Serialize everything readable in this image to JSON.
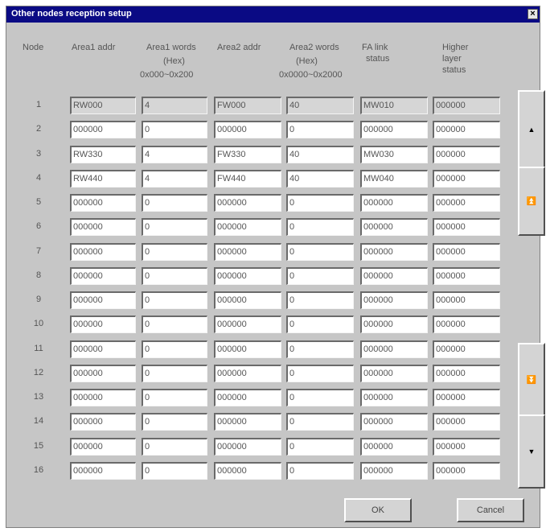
{
  "window": {
    "title": "Other nodes reception setup",
    "close_glyph": "×"
  },
  "headers": {
    "node": "Node",
    "area1_addr": "Area1 addr",
    "area1_words": "Area1 words",
    "area1_words_hex": "(Hex)",
    "area1_words_range": "0x000~0x200",
    "area2_addr": "Area2 addr",
    "area2_words": "Area2 words",
    "area2_words_hex": "(Hex)",
    "area2_words_range": "0x0000~0x2000",
    "fa_link_1": "FA link",
    "fa_link_2": "status",
    "higher_1": "Higher",
    "higher_2": "layer",
    "higher_3": "status"
  },
  "rows": [
    {
      "node": "1",
      "a1addr": "RW000",
      "a1words": "4",
      "a2addr": "FW000",
      "a2words": "40",
      "fa": "MW010",
      "hl": "000000",
      "readonly": true
    },
    {
      "node": "2",
      "a1addr": "000000",
      "a1words": "0",
      "a2addr": "000000",
      "a2words": "0",
      "fa": "000000",
      "hl": "000000"
    },
    {
      "node": "3",
      "a1addr": "RW330",
      "a1words": "4",
      "a2addr": "FW330",
      "a2words": "40",
      "fa": "MW030",
      "hl": "000000"
    },
    {
      "node": "4",
      "a1addr": "RW440",
      "a1words": "4",
      "a2addr": "FW440",
      "a2words": "40",
      "fa": "MW040",
      "hl": "000000"
    },
    {
      "node": "5",
      "a1addr": "000000",
      "a1words": "0",
      "a2addr": "000000",
      "a2words": "0",
      "fa": "000000",
      "hl": "000000"
    },
    {
      "node": "6",
      "a1addr": "000000",
      "a1words": "0",
      "a2addr": "000000",
      "a2words": "0",
      "fa": "000000",
      "hl": "000000"
    },
    {
      "node": "7",
      "a1addr": "000000",
      "a1words": "0",
      "a2addr": "000000",
      "a2words": "0",
      "fa": "000000",
      "hl": "000000"
    },
    {
      "node": "8",
      "a1addr": "000000",
      "a1words": "0",
      "a2addr": "000000",
      "a2words": "0",
      "fa": "000000",
      "hl": "000000"
    },
    {
      "node": "9",
      "a1addr": "000000",
      "a1words": "0",
      "a2addr": "000000",
      "a2words": "0",
      "fa": "000000",
      "hl": "000000"
    },
    {
      "node": "10",
      "a1addr": "000000",
      "a1words": "0",
      "a2addr": "000000",
      "a2words": "0",
      "fa": "000000",
      "hl": "000000"
    },
    {
      "node": "11",
      "a1addr": "000000",
      "a1words": "0",
      "a2addr": "000000",
      "a2words": "0",
      "fa": "000000",
      "hl": "000000"
    },
    {
      "node": "12",
      "a1addr": "000000",
      "a1words": "0",
      "a2addr": "000000",
      "a2words": "0",
      "fa": "000000",
      "hl": "000000"
    },
    {
      "node": "13",
      "a1addr": "000000",
      "a1words": "0",
      "a2addr": "000000",
      "a2words": "0",
      "fa": "000000",
      "hl": "000000"
    },
    {
      "node": "14",
      "a1addr": "000000",
      "a1words": "0",
      "a2addr": "000000",
      "a2words": "0",
      "fa": "000000",
      "hl": "000000"
    },
    {
      "node": "15",
      "a1addr": "000000",
      "a1words": "0",
      "a2addr": "000000",
      "a2words": "0",
      "fa": "000000",
      "hl": "000000"
    },
    {
      "node": "16",
      "a1addr": "000000",
      "a1words": "0",
      "a2addr": "000000",
      "a2words": "0",
      "fa": "000000",
      "hl": "000000"
    }
  ],
  "scroll": {
    "up_icon": "triangle-up-icon",
    "up_glyph": "▲",
    "page_up_icon": "double-up-icon",
    "page_up_glyph": "⏫",
    "page_down_icon": "double-down-icon",
    "page_down_glyph": "⏬",
    "down_icon": "triangle-down-icon",
    "down_glyph": "▼"
  },
  "buttons": {
    "ok": "OK",
    "cancel": "Cancel"
  }
}
